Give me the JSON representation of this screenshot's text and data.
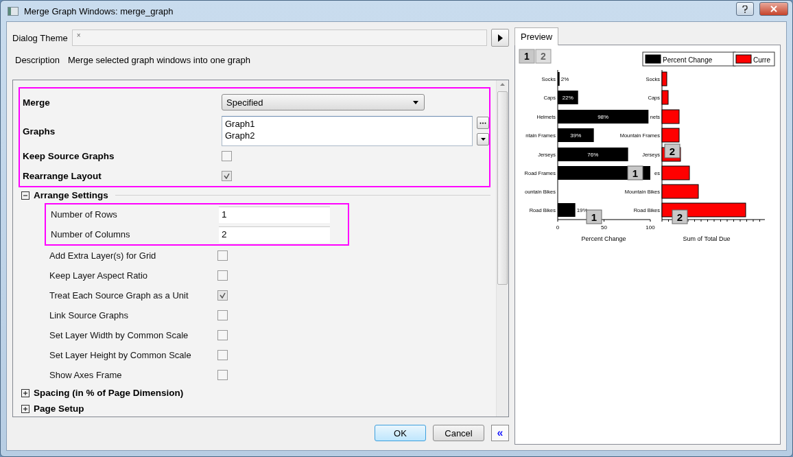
{
  "window": {
    "title": "Merge Graph Windows: merge_graph"
  },
  "dialog_theme": {
    "label": "Dialog Theme",
    "value": "×"
  },
  "description": {
    "label": "Description",
    "value": "Merge selected graph windows into one graph"
  },
  "main_settings": {
    "highlighted": true,
    "items": [
      {
        "kind": "dropdown",
        "label": "Merge",
        "value": "Specified"
      },
      {
        "kind": "list",
        "label": "Graphs",
        "lines": [
          "Graph1",
          "Graph2"
        ]
      },
      {
        "kind": "checkbox",
        "label": "Keep Source Graphs",
        "checked": false
      },
      {
        "kind": "checkbox",
        "label": "Rearrange Layout",
        "checked": true
      }
    ]
  },
  "groups": [
    {
      "label": "Arrange Settings",
      "expanded": true,
      "highlighted_fields": [
        {
          "label": "Number of Rows",
          "value": "1"
        },
        {
          "label": "Number of Columns",
          "value": "2"
        }
      ],
      "options": [
        {
          "label": "Add Extra Layer(s) for Grid",
          "checked": false
        },
        {
          "label": "Keep Layer Aspect Ratio",
          "checked": false
        },
        {
          "label": "Treat Each Source Graph as a Unit",
          "checked": true
        },
        {
          "label": "Link Source Graphs",
          "checked": false
        },
        {
          "label": "Set Layer Width by Common Scale",
          "checked": false
        },
        {
          "label": "Set Layer Height by Common Scale",
          "checked": false
        },
        {
          "label": "Show Axes Frame",
          "checked": false
        }
      ]
    },
    {
      "label": "Spacing (in % of Page Dimension)",
      "expanded": false
    },
    {
      "label": "Page Setup",
      "expanded": false
    }
  ],
  "buttons": [
    {
      "label": "OK",
      "default": true
    },
    {
      "label": "Cancel",
      "default": false
    }
  ],
  "collapse_button": {
    "label": "«"
  },
  "preview": {
    "tab": "Preview",
    "pages": [
      {
        "label": "1",
        "selected": true
      },
      {
        "label": "2",
        "selected": false
      }
    ],
    "right_legend": {
      "label": "Curre",
      "color": "#ff0000"
    },
    "layer_badges": [
      "1",
      "2",
      "1",
      "2"
    ],
    "left_chart": {
      "chart_data": {
        "type": "bar",
        "orientation": "horizontal",
        "xlabel": "Percent Change",
        "categories": [
          "Socks",
          "Caps",
          "Helmets",
          "ntain Frames",
          "Jerseys",
          "Road Frames",
          "ountain Bikes",
          "Road Bikes"
        ],
        "series": [
          {
            "name": "Percent Change",
            "color": "#000000",
            "values": [
              2,
              22,
              98,
              39,
              76,
              100,
              null,
              19
            ]
          }
        ],
        "xlim": [
          0,
          100
        ],
        "xticks": [
          0,
          50,
          100
        ],
        "value_labels": [
          "2%",
          "22%",
          "98%",
          "39%",
          "76%",
          null,
          null,
          "19%"
        ]
      }
    },
    "right_chart": {
      "xlabel": "Sum of Total Due",
      "categories": [
        "Socks",
        "Caps",
        "nets",
        "Mountain Frames",
        "Jerseys",
        "es",
        "Mountain Bikes",
        "Road Bikes"
      ]
    }
  }
}
